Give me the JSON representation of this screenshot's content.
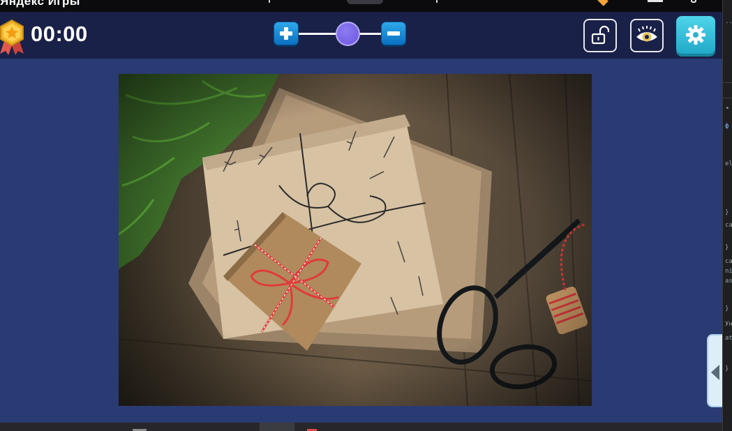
{
  "browser": {
    "brand_text": "Яндекс Игры"
  },
  "header": {
    "timer": "00:00",
    "zoom": {
      "plus_icon": "plus-icon",
      "minus_icon": "minus-icon",
      "level": 0.5
    },
    "buttons": [
      {
        "name": "lock-button",
        "icon": "unlock-icon"
      },
      {
        "name": "preview-button",
        "icon": "eye-icon"
      },
      {
        "name": "settings-button",
        "icon": "gear-icon"
      }
    ]
  },
  "puzzle": {
    "image_description_icon": "gift-boxes-image"
  },
  "devtools": {
    "lines": [
      "...",
      "◂",
      "ф",
      "el",
      "}",
      "ca",
      "}",
      "ca",
      "ni",
      "as",
      "}",
      "Ун",
      "at",
      "}"
    ]
  },
  "colors": {
    "header_bg": "#1a2148",
    "play_bg": "#2a3a72",
    "zoom_button": "#1a8ad6",
    "zoom_knob": "#7a66e8",
    "settings_button": "#3cc4e0"
  }
}
